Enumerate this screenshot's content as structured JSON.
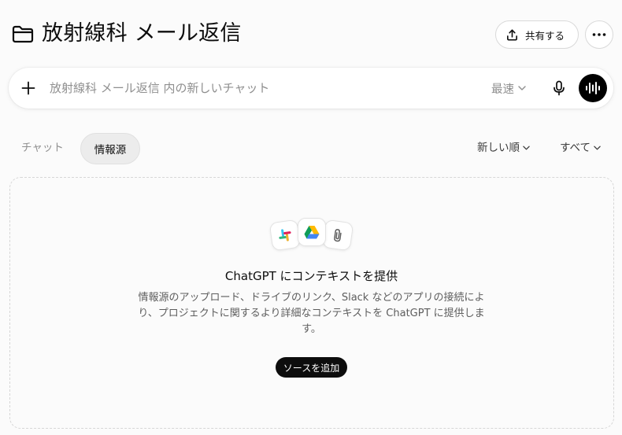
{
  "header": {
    "title": "放射線科 メール返信",
    "share_label": "共有する"
  },
  "composer": {
    "placeholder": "放射線科 メール返信 内の新しいチャット",
    "model_label": "最速"
  },
  "tabs": [
    {
      "label": "チャット",
      "active": false
    },
    {
      "label": "情報源",
      "active": true
    }
  ],
  "sort_label": "新しい順",
  "filter_label": "すべて",
  "sources_empty": {
    "title": "ChatGPT にコンテキストを提供",
    "description": "情報源のアップロード、ドライブのリンク、Slack などのアプリの接続により、プロジェクトに関するより詳細なコンテキストを ChatGPT に提供します。",
    "add_button_label": "ソースを追加"
  },
  "icons": {
    "title": "folder-icon",
    "share": "upload-icon",
    "more": "ellipsis-icon",
    "composer_add": "plus-icon",
    "mic": "microphone-icon",
    "voice": "voice-waveform-icon",
    "apps": [
      "slack-icon",
      "google-drive-icon",
      "paperclip-icon"
    ]
  },
  "colors": {
    "background": "#fbfbfb",
    "active_tab": "#ececec",
    "primary_button": "#0d0d0d",
    "muted_text": "#8f8f8f"
  }
}
